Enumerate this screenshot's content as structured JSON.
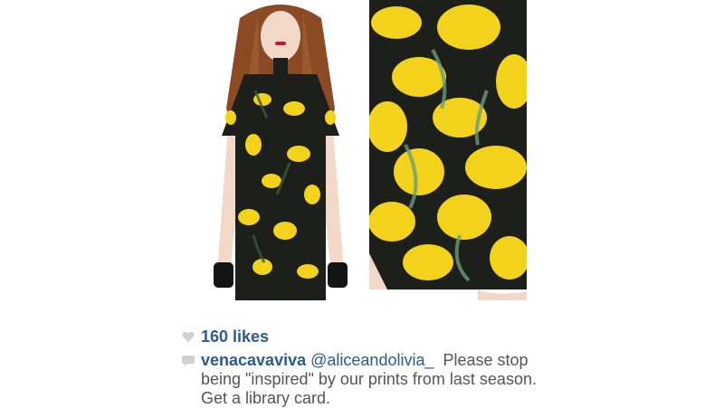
{
  "post": {
    "likes_label": "160 likes",
    "comment": {
      "username": "venacavaviva",
      "mention": "@aliceandolivia_",
      "text": "Please stop being \"inspired\" by our prints from last season. Get a library card."
    }
  },
  "icons": {
    "heart": "heart-icon",
    "comment": "speech-bubble-icon"
  },
  "colors": {
    "link_blue": "#2a5b8a",
    "text_gray": "#555555",
    "print_yellow": "#f3d21b",
    "print_black": "#1d1f1a"
  }
}
